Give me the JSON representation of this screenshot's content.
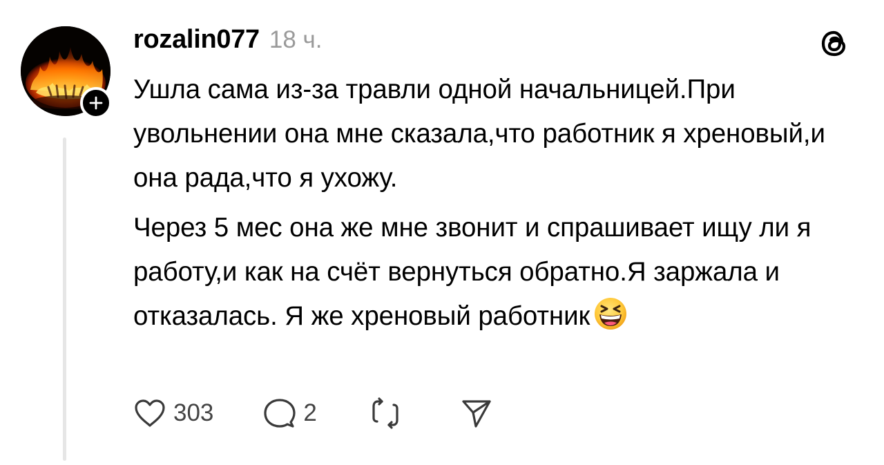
{
  "post": {
    "username": "rozalin077",
    "timestamp": "18 ч.",
    "paragraphs": [
      "Ушла сама из-за травли одной начальницей.При увольнении она мне сказала,что работник я хреновый,и она рада,что я ухожу.",
      "Через 5 мес она же мне звонит и спрашивает ищу ли я работу,и как на счёт вернуться обратно.Я заржала и отказалась. Я же хреновый работник"
    ],
    "emoji": "grinning-squinting-face"
  },
  "actions": {
    "like_count": "303",
    "reply_count": "2"
  },
  "icons": {
    "brand": "threads-logo-icon",
    "like": "heart-icon",
    "reply": "comment-bubble-icon",
    "repost": "repost-icon",
    "share": "send-icon",
    "follow": "plus-icon"
  },
  "colors": {
    "text": "#000000",
    "muted": "#9a9a9a",
    "thread_line": "#e6e6e6"
  }
}
